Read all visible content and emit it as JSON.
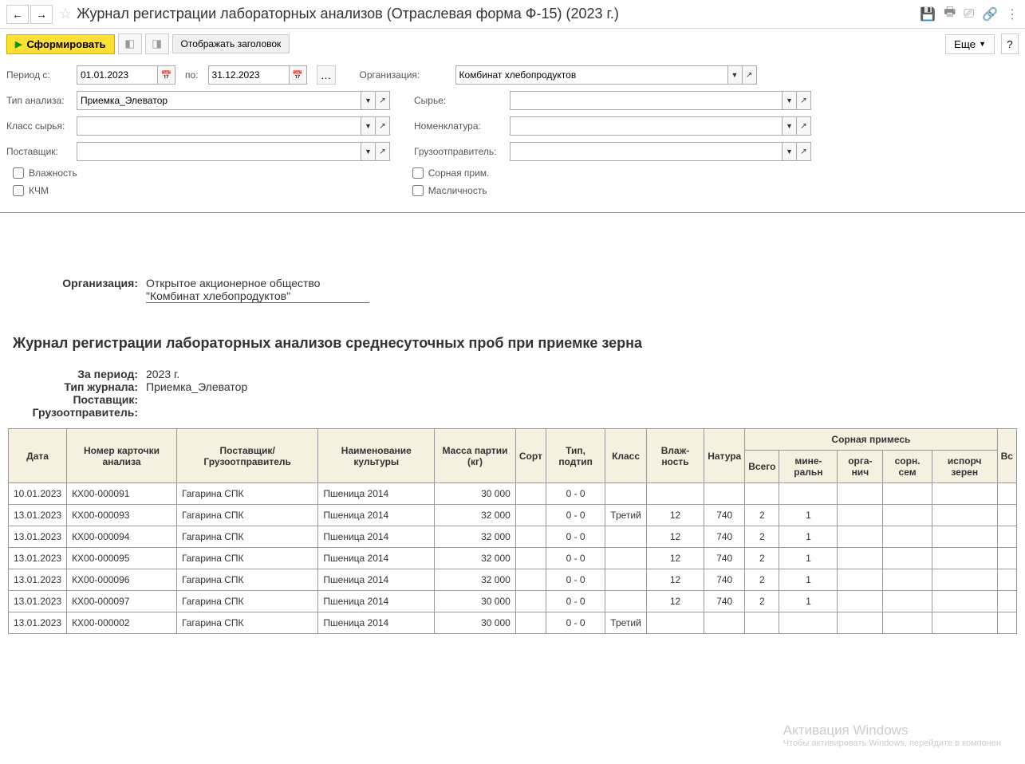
{
  "header": {
    "title": "Журнал регистрации лабораторных анализов (Отраслевая форма Ф-15) (2023 г.)"
  },
  "toolbar": {
    "generate": "Сформировать",
    "show_header": "Отображать заголовок",
    "more": "Еще"
  },
  "filters": {
    "period_from_label": "Период с:",
    "period_from": "01.01.2023",
    "period_to_label": "по:",
    "period_to": "31.12.2023",
    "org_label": "Организация:",
    "org_value": "Комбинат хлебопродуктов",
    "type_label": "Тип анализа:",
    "type_value": "Приемка_Элеватор",
    "raw_label": "Сырье:",
    "raw_value": "",
    "class_label": "Класс сырья:",
    "class_value": "",
    "nomen_label": "Номенклатура:",
    "nomen_value": "",
    "supplier_label": "Поставщик:",
    "supplier_value": "",
    "shipper_label": "Грузоотправитель:",
    "shipper_value": "",
    "cb_humidity": "Влажность",
    "cb_kchm": "КЧМ",
    "cb_weed": "Сорная прим.",
    "cb_oil": "Масличность"
  },
  "report": {
    "org_label": "Организация:",
    "org_value1": "Открытое акционерное общество",
    "org_value2": "\"Комбинат хлебопродуктов\"",
    "title": "Журнал регистрации лабораторных анализов среднесуточных проб при приемке зерна",
    "period_label": "За период:",
    "period_value": "2023 г.",
    "journal_type_label": "Тип журнала:",
    "journal_type_value": "Приемка_Элеватор",
    "supplier_label": "Поставщик:",
    "shipper_label": "Грузоотправитель:"
  },
  "table": {
    "headers": {
      "date": "Дата",
      "card": "Номер карточки анализа",
      "supplier": "Поставщик/ Грузоотправитель",
      "crop": "Наименование культуры",
      "mass": "Масса партии (кг)",
      "sort": "Сорт",
      "type": "Тип, подтип",
      "class": "Класс",
      "humidity": "Влаж-ность",
      "nature": "Натура",
      "weed_group": "Сорная примесь",
      "weed_total": "Всего",
      "weed_mineral": "мине-ральн",
      "weed_organic": "орга-нич",
      "weed_seeds": "сорн. сем",
      "weed_spoiled": "испорч зерен",
      "other": "Вс"
    },
    "rows": [
      {
        "date": "10.01.2023",
        "card": "КХ00-000091",
        "supplier": "Гагарина СПК",
        "crop": "Пшеница 2014",
        "mass": "30 000",
        "sort": "",
        "type": "0 - 0",
        "class": "",
        "humidity": "",
        "nature": "",
        "wt": "",
        "wm": "",
        "wo": "",
        "ws": "",
        "wp": ""
      },
      {
        "date": "13.01.2023",
        "card": "КХ00-000093",
        "supplier": "Гагарина СПК",
        "crop": "Пшеница 2014",
        "mass": "32 000",
        "sort": "",
        "type": "0 - 0",
        "class": "Третий",
        "humidity": "12",
        "nature": "740",
        "wt": "2",
        "wm": "1",
        "wo": "",
        "ws": "",
        "wp": ""
      },
      {
        "date": "13.01.2023",
        "card": "КХ00-000094",
        "supplier": "Гагарина СПК",
        "crop": "Пшеница 2014",
        "mass": "32 000",
        "sort": "",
        "type": "0 - 0",
        "class": "",
        "humidity": "12",
        "nature": "740",
        "wt": "2",
        "wm": "1",
        "wo": "",
        "ws": "",
        "wp": ""
      },
      {
        "date": "13.01.2023",
        "card": "КХ00-000095",
        "supplier": "Гагарина СПК",
        "crop": "Пшеница 2014",
        "mass": "32 000",
        "sort": "",
        "type": "0 - 0",
        "class": "",
        "humidity": "12",
        "nature": "740",
        "wt": "2",
        "wm": "1",
        "wo": "",
        "ws": "",
        "wp": ""
      },
      {
        "date": "13.01.2023",
        "card": "КХ00-000096",
        "supplier": "Гагарина СПК",
        "crop": "Пшеница 2014",
        "mass": "32 000",
        "sort": "",
        "type": "0 - 0",
        "class": "",
        "humidity": "12",
        "nature": "740",
        "wt": "2",
        "wm": "1",
        "wo": "",
        "ws": "",
        "wp": ""
      },
      {
        "date": "13.01.2023",
        "card": "КХ00-000097",
        "supplier": "Гагарина СПК",
        "crop": "Пшеница 2014",
        "mass": "30 000",
        "sort": "",
        "type": "0 - 0",
        "class": "",
        "humidity": "12",
        "nature": "740",
        "wt": "2",
        "wm": "1",
        "wo": "",
        "ws": "",
        "wp": ""
      },
      {
        "date": "13.01.2023",
        "card": "КХ00-000002",
        "supplier": "Гагарина СПК",
        "crop": "Пшеница 2014",
        "mass": "30 000",
        "sort": "",
        "type": "0 - 0",
        "class": "Третий",
        "humidity": "",
        "nature": "",
        "wt": "",
        "wm": "",
        "wo": "",
        "ws": "",
        "wp": ""
      }
    ]
  },
  "watermark": {
    "line1": "Активация Windows",
    "line2": "Чтобы активировать Windows, перейдите в компонен"
  }
}
